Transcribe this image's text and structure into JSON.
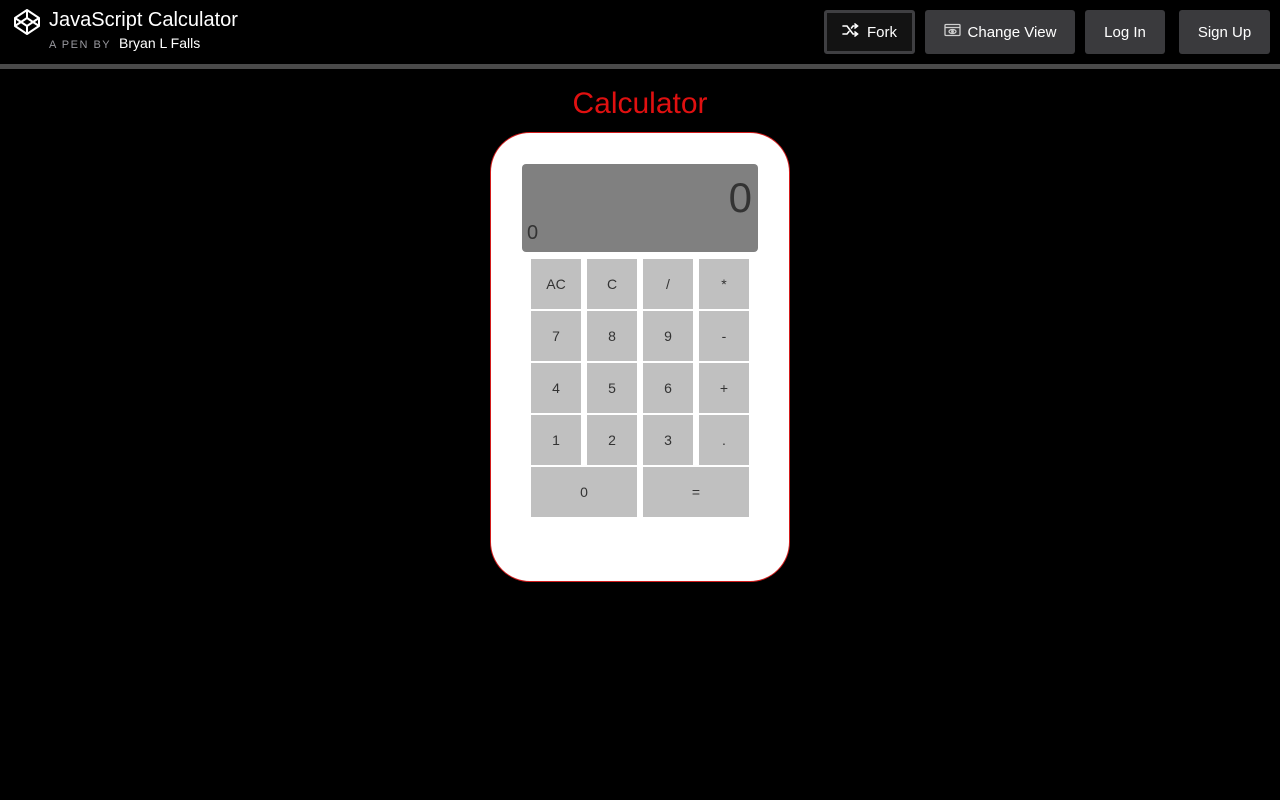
{
  "header": {
    "pen_title": "JavaScript Calculator",
    "byline_prefix": "A PEN BY",
    "author": "Bryan L Falls",
    "logo_icon": "codepen-logo-icon",
    "buttons": {
      "fork": "Fork",
      "change_view": "Change View",
      "log_in": "Log In",
      "sign_up": "Sign Up"
    }
  },
  "calculator": {
    "title": "Calculator",
    "display": {
      "value": "0",
      "formula": "0"
    },
    "keys": {
      "clear_all": "AC",
      "clear": "C",
      "divide": "/",
      "multiply": "*",
      "seven": "7",
      "eight": "8",
      "nine": "9",
      "subtract": "-",
      "four": "4",
      "five": "5",
      "six": "6",
      "add": "+",
      "one": "1",
      "two": "2",
      "three": "3",
      "decimal": ".",
      "zero": "0",
      "equals": "="
    }
  },
  "colors": {
    "title_red": "#e01010",
    "body_border": "#d21c1c",
    "display_bg": "#808080",
    "key_bg": "#c0c0c0",
    "header_button_bg": "#3a3a3d"
  }
}
